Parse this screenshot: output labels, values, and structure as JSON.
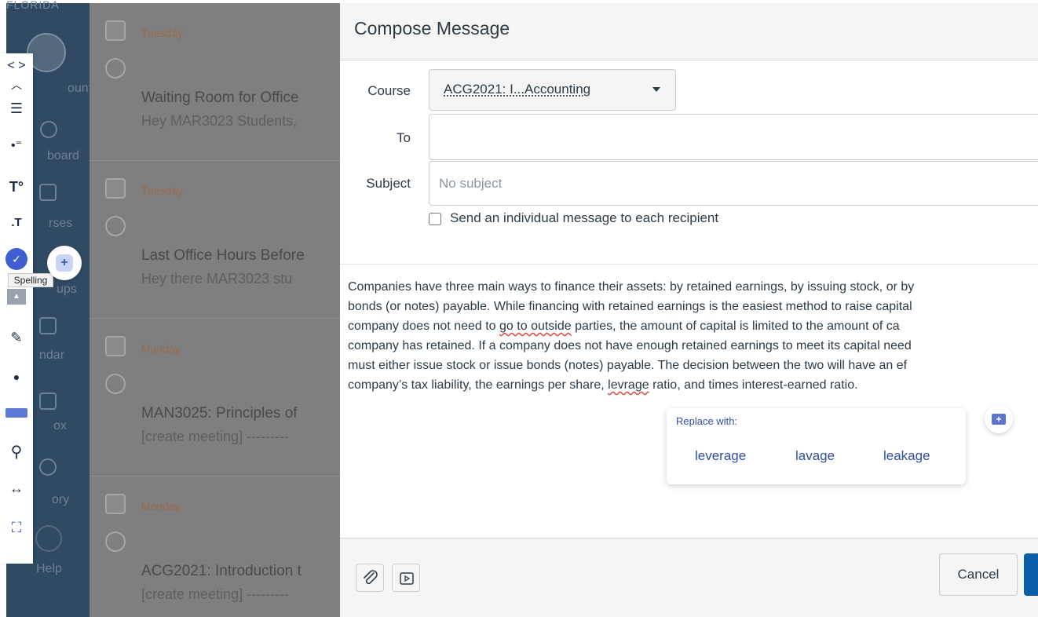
{
  "global_nav": {
    "logo_text": "FLORIDA",
    "items": [
      {
        "label": "Account",
        "visible_text": "ount"
      },
      {
        "label": "Dashboard",
        "visible_text": "board"
      },
      {
        "label": "Courses",
        "visible_text": "rses"
      },
      {
        "label": "Groups",
        "visible_text": "ups"
      },
      {
        "label": "Calendar",
        "visible_text": "ndar"
      },
      {
        "label": "Inbox",
        "visible_text": "ox"
      },
      {
        "label": "History",
        "visible_text": "ory"
      },
      {
        "label": "Help",
        "visible_text": "Help"
      }
    ]
  },
  "messages": [
    {
      "date": "Tuesday",
      "title": "Waiting Room for Office",
      "preview": "Hey MAR3023 Students,"
    },
    {
      "date": "Tuesday",
      "title": "Last Office Hours Before",
      "preview": "Hey there MAR3023 stu"
    },
    {
      "date": "Monday",
      "title": "MAN3025: Principles of",
      "preview": "[create meeting] ---------"
    },
    {
      "date": "Monday",
      "title": "ACG2021: Introduction t",
      "preview": "[create meeting] ---------"
    }
  ],
  "compose": {
    "title": "Compose Message",
    "course_label": "Course",
    "course_value": "ACG2021: I...Accounting",
    "to_label": "To",
    "subject_label": "Subject",
    "subject_placeholder": "No subject",
    "individual_label": "Send an individual message to each recipient",
    "body": {
      "line1": "Companies have three main ways to finance their assets: by retained earnings, by issuing stock, or by",
      "line2": "bonds (or notes) payable. While financing with retained earnings is the easiest method to raise capital",
      "line3_pre": "company does not need to ",
      "line3_misspelled": "go to outside",
      "line3_post": " parties, the amount of capital is limited to the amount of ca",
      "line4": "company has retained. If a company does not have enough retained earnings to meet its capital need",
      "line5": "must either issue stock or issue bonds (notes) payable. The decision between the two will have an ef",
      "line6_pre": "company’s tax liability, the earnings per share, ",
      "line6_misspelled": "levrage",
      "line6_post": " ratio, and times interest-earned ratio."
    },
    "spell_popup": {
      "title": "Replace with:",
      "suggestions": [
        "leverage",
        "lavage",
        "leakage"
      ]
    },
    "cancel_label": "Cancel"
  },
  "toolbar": {
    "spelling_tooltip": "Spelling",
    "tools": [
      "code-brackets-icon",
      "chevron-up-icon",
      "list-icon",
      "toggle-dots-icon",
      "text-size-up-icon",
      "text-size-down-icon",
      "spelling-check-icon",
      "image-icon",
      "edit-icon",
      "play-icon",
      "highlight-bar-icon",
      "search-icon",
      "text-spacing-icon",
      "screen-mask-icon"
    ]
  }
}
